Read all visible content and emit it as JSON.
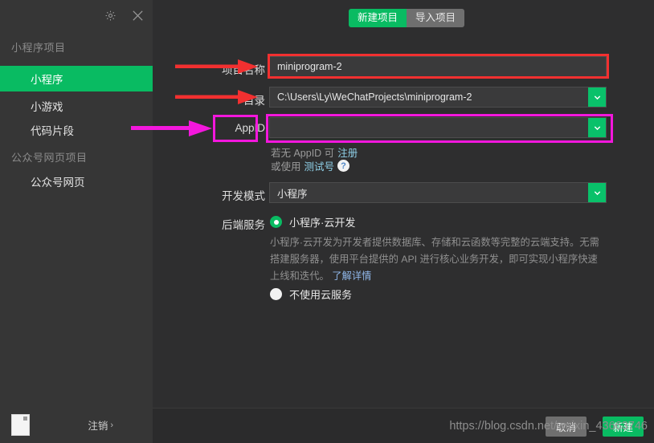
{
  "window": {
    "gear_icon": "gear-icon",
    "close_icon": "close-icon"
  },
  "sidebar": {
    "group1_title": "小程序项目",
    "group2_title": "公众号网页项目",
    "items": [
      {
        "label": "小程序",
        "active": true
      },
      {
        "label": "小游戏",
        "active": false
      },
      {
        "label": "代码片段",
        "active": false
      },
      {
        "label": "公众号网页",
        "active": false
      }
    ],
    "footer": {
      "avatar": "avatar",
      "logout_label": "注销",
      "logout_chevron": "›"
    }
  },
  "main": {
    "tabs": [
      {
        "label": "新建项目",
        "active": true
      },
      {
        "label": "导入项目",
        "active": false
      }
    ],
    "form": {
      "project_name": {
        "label": "项目名称",
        "value": "miniprogram-2",
        "placeholder": ""
      },
      "directory": {
        "label": "目录",
        "value": "C:\\Users\\Ly\\WeChatProjects\\miniprogram-2",
        "dropdown_icon": "chevron-down-icon"
      },
      "appid": {
        "label": "AppID",
        "value": "",
        "placeholder": "",
        "dropdown_icon": "chevron-down-icon",
        "hint_line1_prefix": "若无 AppID 可",
        "hint_line1_link": "注册",
        "hint_line2_prefix": "或使用",
        "hint_line2_link": "测试号",
        "help_icon_label": "?"
      },
      "dev_mode": {
        "label": "开发模式",
        "value": "小程序",
        "dropdown_icon": "chevron-down-icon"
      },
      "backend": {
        "label": "后端服务",
        "option1_label": "小程序·云开发",
        "option1_selected": true,
        "option1_desc": "小程序·云开发为开发者提供数据库、存储和云函数等完整的云端支持。无需搭建服务器，使用平台提供的 API 进行核心业务开发，即可实现小程序快速上线和迭代。",
        "option1_desc_link": "了解详情",
        "option2_label": "不使用云服务",
        "option2_selected": false
      }
    }
  },
  "bottom": {
    "cancel_label": "取消",
    "create_label": "新建",
    "watermark": "https://blog.csdn.net/weixin_43663746"
  },
  "annotations": {
    "accent_red": "#f23030",
    "accent_magenta": "#f317dd",
    "arrows": [
      {
        "name": "arrow-project-name",
        "color": "#f23030"
      },
      {
        "name": "arrow-directory",
        "color": "#f23030"
      },
      {
        "name": "arrow-appid",
        "color": "#f317dd"
      }
    ],
    "boxes": [
      {
        "name": "box-project-name-field",
        "color": "#f23030"
      },
      {
        "name": "box-appid-label",
        "color": "#f317dd"
      },
      {
        "name": "box-appid-field",
        "color": "#f317dd"
      }
    ]
  },
  "colors": {
    "brand_green": "#09bb62",
    "sidebar_bg": "#363636",
    "main_bg": "#2e2e2f",
    "field_bg": "#3a3a3b",
    "link_blue": "#8fd0e8"
  }
}
